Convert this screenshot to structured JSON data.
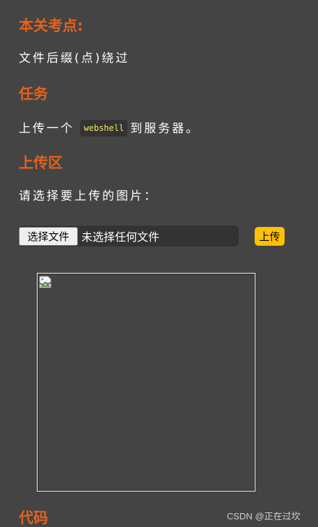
{
  "sections": {
    "key_point": {
      "title": "本关考点:",
      "text": "文件后缀(点)绕过"
    },
    "task": {
      "title": "任务",
      "text_before": "上传一个",
      "code": "webshell",
      "text_after": "到服务器。"
    },
    "upload_area": {
      "title": "上传区",
      "prompt": "请选择要上传的图片：",
      "choose_file_label": "选择文件",
      "no_file_text": "未选择任何文件",
      "upload_button_label": "上传"
    },
    "code": {
      "title": "代码"
    }
  },
  "preview": {
    "icon": "broken-image-icon"
  },
  "watermark": "CSDN @正在过坎",
  "colors": {
    "background": "#444444",
    "heading": "#e8611a",
    "upload_button": "#ffc107",
    "code_text": "#f5e56b"
  }
}
